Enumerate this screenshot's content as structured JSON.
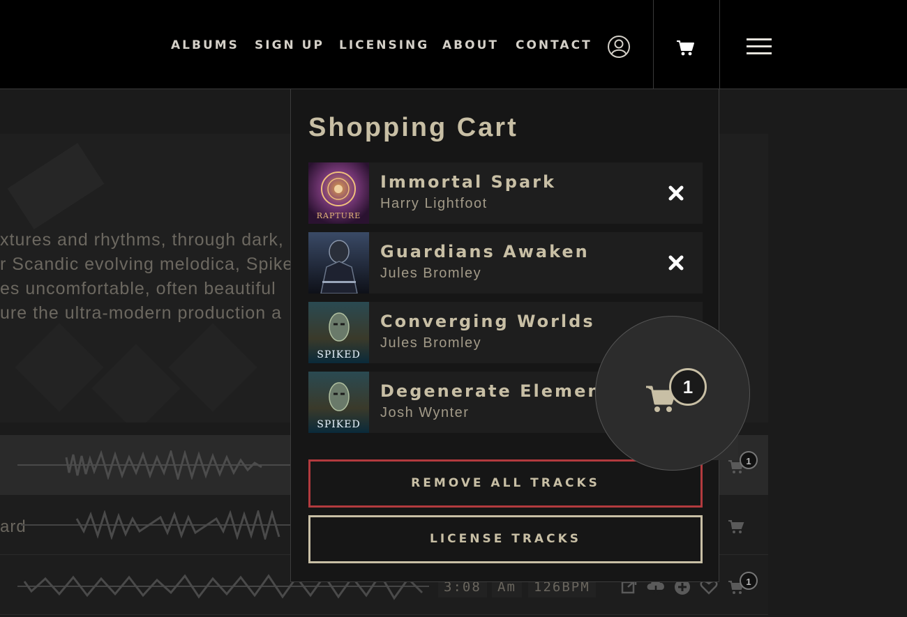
{
  "nav": {
    "links": [
      "ALBUMS",
      "SIGN UP",
      "LICENSING",
      "ABOUT",
      "CONTACT"
    ]
  },
  "hero": {
    "lines": [
      "xtures and rhythms, through dark,",
      "r Scandic evolving melodica, Spike",
      "es uncomfortable, often beautiful",
      "ure the ultra-modern production a"
    ]
  },
  "tracks": {
    "row2_label": "ard",
    "row3": {
      "duration": "3:08",
      "key": "Am",
      "bpm": "126BPM"
    },
    "badges": [
      "1",
      "1"
    ]
  },
  "cart": {
    "title": "Shopping Cart",
    "items": [
      {
        "title": "Immortal Spark",
        "artist": "Harry Lightfoot",
        "cover_text": "RAPTURE"
      },
      {
        "title": "Guardians Awaken",
        "artist": "Jules Bromley",
        "cover_text": ""
      },
      {
        "title": "Converging Worlds",
        "artist": "Jules Bromley",
        "cover_text": "SPIKED"
      },
      {
        "title": "Degenerate Elements",
        "artist": "Josh Wynter",
        "cover_text": "SPIKED"
      }
    ],
    "remove_all_label": "REMOVE ALL TRACKS",
    "license_label": "LICENSE TRACKS",
    "bubble_count": "1"
  },
  "colors": {
    "accent": "#c8bfa5",
    "danger": "#b23a3e",
    "nav_bg": "#000000",
    "panel_bg": "#161616"
  },
  "icons": [
    "user-icon",
    "cart-icon",
    "hamburger-menu-icon",
    "close-icon",
    "share-icon",
    "download-icon",
    "add-icon",
    "heart-icon"
  ]
}
